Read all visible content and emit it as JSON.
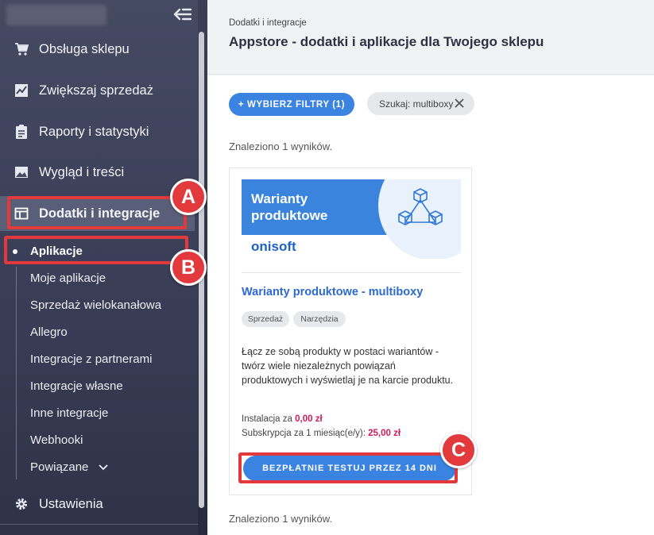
{
  "sidebar": {
    "nav": [
      {
        "label": "Obsługa sklepu",
        "icon": "cart-icon"
      },
      {
        "label": "Zwiększaj sprzedaż",
        "icon": "chart-icon"
      },
      {
        "label": "Raporty i statystyki",
        "icon": "clipboard-icon"
      },
      {
        "label": "Wygląd i treści",
        "icon": "image-icon"
      },
      {
        "label": "Dodatki i integracje",
        "icon": "window-icon"
      }
    ],
    "sub": [
      "Aplikacje",
      "Moje aplikacje",
      "Sprzedaż wielokanałowa",
      "Allegro",
      "Integracje z partnerami",
      "Integracje własne",
      "Inne integracje",
      "Webhooki",
      "Powiązane"
    ],
    "settings": "Ustawienia"
  },
  "annotations": {
    "a": "A",
    "b": "B",
    "c": "C"
  },
  "header": {
    "breadcrumb": "Dodatki i integracje",
    "title": "Appstore - dodatki i aplikacje dla Twojego sklepu"
  },
  "toolbar": {
    "filter_label": "+ WYBIERZ FILTRY (1)",
    "search_chip": "Szukaj: multiboxy"
  },
  "results": {
    "found_top": "Znaleziono 1 wyników.",
    "found_bottom": "Znaleziono 1 wyników."
  },
  "card": {
    "banner_line1": "Warianty",
    "banner_line2": "produktowe",
    "banner_logo": "onisoft",
    "title": "Warianty produktowe - multiboxy",
    "tags": [
      "Sprzedaż",
      "Narzędzia"
    ],
    "description": "Łącz ze sobą produkty w postaci wariantów - twórz wiele niezależnych powiązań produktowych i wyświetlaj je na karcie produktu.",
    "install_label": "Instalacja za",
    "install_price": "0,00 zł",
    "sub_label": "Subskrypcja za 1 miesiąc(e/y):",
    "sub_price": "25,00 zł",
    "trial_label": "BEZPŁATNIE TESTUJ PRZEZ 14 DNI"
  },
  "colors": {
    "accent": "#3a83e0",
    "annotation": "#e2393d",
    "price": "#d3195b"
  }
}
